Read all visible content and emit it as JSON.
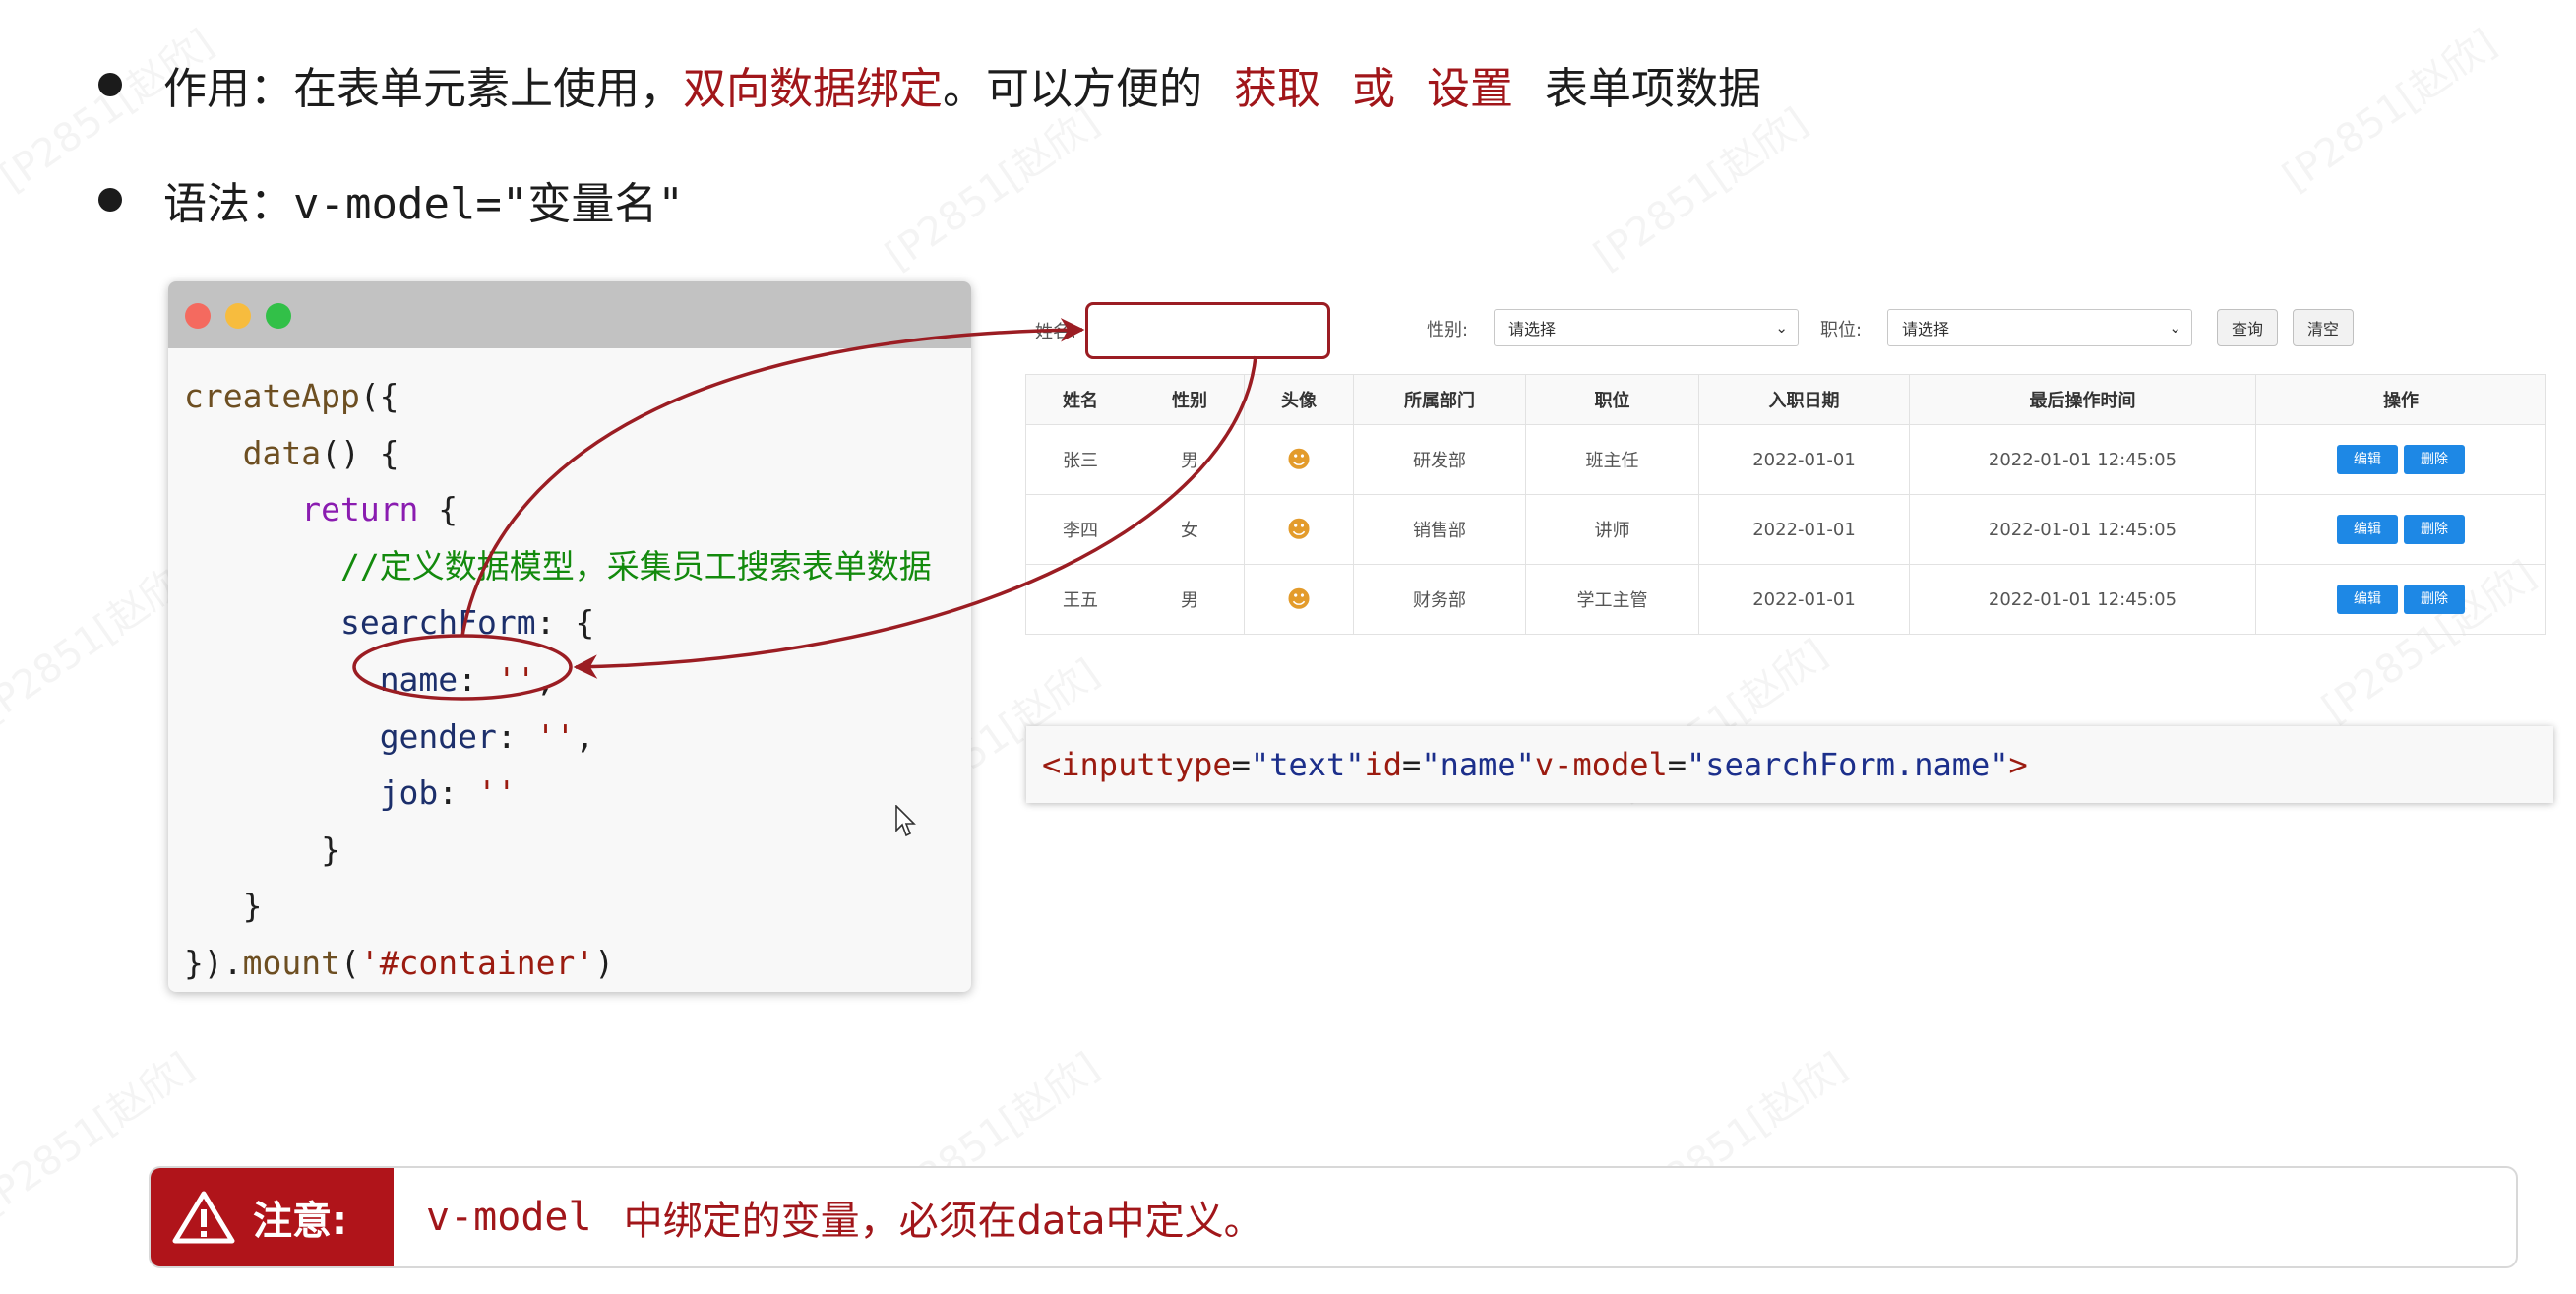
{
  "bullets": [
    {
      "prefix": "作用：在表单元素上使用，",
      "emphasis": "双向数据绑定",
      "middle": "。可以方便的",
      "get": "获取",
      "or": "或",
      "set": "设置",
      "suffix": "表单项数据"
    },
    {
      "text": "语法：v-model=\"变量名\""
    }
  ],
  "code": {
    "l1_fn": "createApp",
    "l1_rest": "({",
    "l2_fn": "data",
    "l2_rest": "() {",
    "l3_kw": "return",
    "l3_rest": " {",
    "l4_comment": "//定义数据模型，采集员工搜索表单数据",
    "l5_prop": "searchForm",
    "l5_rest": ": {",
    "l6_prop": "name",
    "l6_colon": ": ",
    "l6_str": "''",
    "l6_comma": ",",
    "l7_prop": "gender",
    "l7_colon": ": ",
    "l7_str": "''",
    "l7_comma": ",",
    "l8_prop": "job",
    "l8_colon": ": ",
    "l8_str": "''",
    "l9": "}",
    "l10": "}",
    "l11_pre": "}).",
    "l11_fn": "mount",
    "l11_open": "(",
    "l11_str": "'#container'",
    "l11_close": ")"
  },
  "form": {
    "name_label": "姓名:",
    "gender_label": "性别:",
    "gender_value": "请选择",
    "job_label": "职位:",
    "job_value": "请选择",
    "search_btn": "查询",
    "clear_btn": "清空"
  },
  "table": {
    "headers": [
      "姓名",
      "性别",
      "头像",
      "所属部门",
      "职位",
      "入职日期",
      "最后操作时间",
      "操作"
    ],
    "rows": [
      {
        "name": "张三",
        "gender": "男",
        "dept": "研发部",
        "job": "班主任",
        "date": "2022-01-01",
        "time": "2022-01-01 12:45:05"
      },
      {
        "name": "李四",
        "gender": "女",
        "dept": "销售部",
        "job": "讲师",
        "date": "2022-01-01",
        "time": "2022-01-01 12:45:05"
      },
      {
        "name": "王五",
        "gender": "男",
        "dept": "财务部",
        "job": "学工主管",
        "date": "2022-01-01",
        "time": "2022-01-01 12:45:05"
      }
    ],
    "edit_btn": "编辑",
    "delete_btn": "删除"
  },
  "input_code": {
    "open": "<input",
    "type_attr": "type",
    "type_val": "\"text\"",
    "id_attr": "id",
    "id_val": "\"name\"",
    "model_attr": "v-model",
    "model_val": "\"searchForm.name\"",
    "close": ">",
    "eq": "="
  },
  "notice": {
    "title": "注意:",
    "code": "v-model",
    "text": "中绑定的变量，必须在data中定义。"
  },
  "watermark": "[P2851[赵欣]",
  "colors": {
    "emphasis_red": "#a1161a",
    "notice_red": "#b0141a",
    "annotation_red": "#9b1d23",
    "button_blue": "#1e88e5"
  }
}
